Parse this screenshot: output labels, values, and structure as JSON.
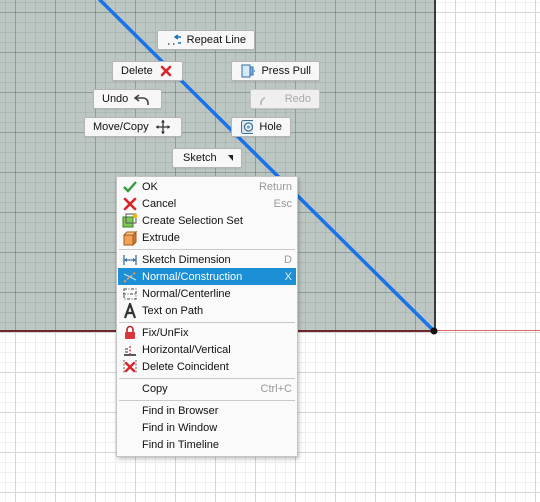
{
  "marking_menu": {
    "repeat": "Repeat Line",
    "delete": "Delete",
    "press_pull": "Press Pull",
    "undo": "Undo",
    "redo": "Redo",
    "move_copy": "Move/Copy",
    "hole": "Hole",
    "sketch": "Sketch"
  },
  "context_menu": {
    "items": [
      {
        "label": "OK",
        "shortcut": "Return",
        "icon": "check-icon"
      },
      {
        "label": "Cancel",
        "shortcut": "Esc",
        "icon": "cross-icon"
      },
      {
        "label": "Create Selection Set",
        "shortcut": "",
        "icon": "selection-set-icon"
      },
      {
        "label": "Extrude",
        "shortcut": "",
        "icon": "extrude-icon"
      },
      {
        "label": "Sketch Dimension",
        "shortcut": "D",
        "icon": "dimension-icon"
      },
      {
        "label": "Normal/Construction",
        "shortcut": "X",
        "icon": "construction-icon",
        "highlighted": true
      },
      {
        "label": "Normal/Centerline",
        "shortcut": "",
        "icon": "centerline-icon"
      },
      {
        "label": "Text on Path",
        "shortcut": "",
        "icon": "text-icon"
      },
      {
        "label": "Fix/UnFix",
        "shortcut": "",
        "icon": "lock-icon"
      },
      {
        "label": "Horizontal/Vertical",
        "shortcut": "",
        "icon": "horizontal-vertical-icon"
      },
      {
        "label": "Delete Coincident",
        "shortcut": "",
        "icon": "delete-coincident-icon"
      },
      {
        "label": "Copy",
        "shortcut": "Ctrl+C",
        "icon": ""
      },
      {
        "label": "Find in Browser",
        "shortcut": "",
        "icon": ""
      },
      {
        "label": "Find in Window",
        "shortcut": "",
        "icon": ""
      },
      {
        "label": "Find in Timeline",
        "shortcut": "",
        "icon": ""
      }
    ]
  },
  "colors": {
    "highlight": "#1c8fd6",
    "selected_line": "#1a73e8",
    "sketch_region": "#bcc7c3"
  }
}
